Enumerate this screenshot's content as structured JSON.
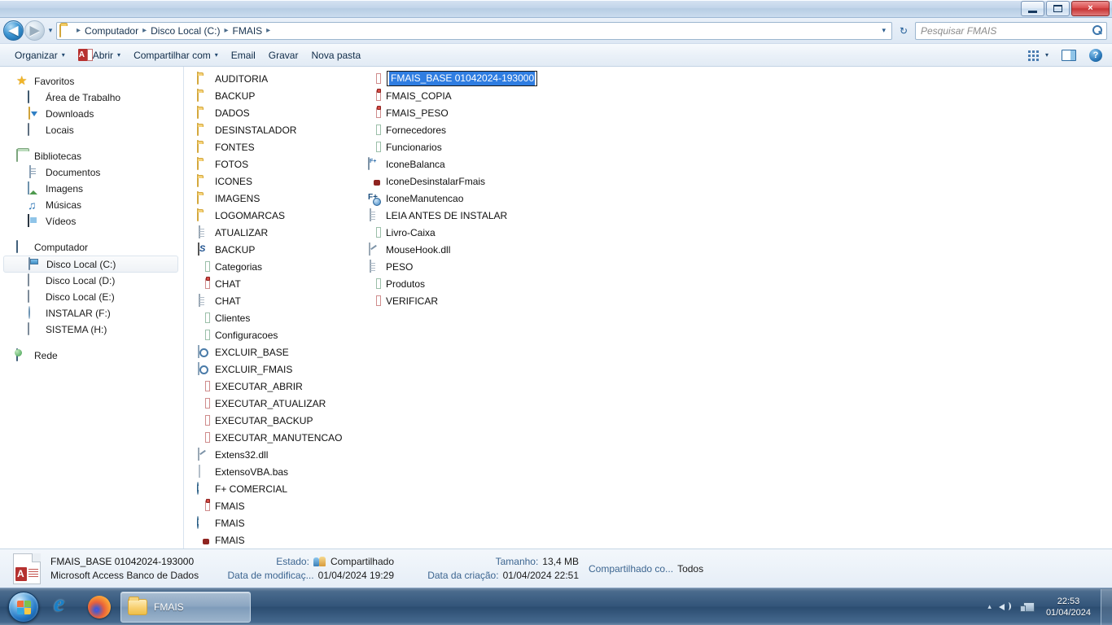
{
  "window": {
    "title": "",
    "controls": {
      "minimize": "minimize-button",
      "maximize": "maximize-button",
      "close": "×"
    }
  },
  "address_bar": {
    "back_label": "◀",
    "forward_label": "▶",
    "history_label": "▾",
    "breadcrumbs": [
      "Computador",
      "Disco Local (C:)",
      "FMAIS"
    ],
    "separator": "▸",
    "dropdown_label": "▾",
    "refresh_label": "↻"
  },
  "search": {
    "placeholder": "Pesquisar FMAIS",
    "value": ""
  },
  "command_bar": {
    "items": [
      {
        "label": "Organizar",
        "has_caret": true,
        "icon": null
      },
      {
        "label": "Abrir",
        "has_caret": true,
        "icon": "access-icon"
      },
      {
        "label": "Compartilhar com",
        "has_caret": true,
        "icon": null
      },
      {
        "label": "Email",
        "has_caret": false,
        "icon": null
      },
      {
        "label": "Gravar",
        "has_caret": false,
        "icon": null
      },
      {
        "label": "Nova pasta",
        "has_caret": false,
        "icon": null
      }
    ],
    "view_caret": "▾",
    "help_label": "?"
  },
  "sidebar": {
    "groups": [
      {
        "header": {
          "label": "Favoritos",
          "icon": "star-icon"
        },
        "items": [
          {
            "label": "Área de Trabalho",
            "icon": "desktop-icon"
          },
          {
            "label": "Downloads",
            "icon": "downloads-icon"
          },
          {
            "label": "Locais",
            "icon": "recent-places-icon"
          }
        ]
      },
      {
        "header": {
          "label": "Bibliotecas",
          "icon": "libraries-icon"
        },
        "items": [
          {
            "label": "Documentos",
            "icon": "documents-icon"
          },
          {
            "label": "Imagens",
            "icon": "pictures-icon"
          },
          {
            "label": "Músicas",
            "icon": "music-icon"
          },
          {
            "label": "Vídeos",
            "icon": "videos-icon"
          }
        ]
      },
      {
        "header": {
          "label": "Computador",
          "icon": "computer-icon"
        },
        "items": [
          {
            "label": "Disco Local (C:)",
            "icon": "hard-drive-system-icon",
            "selected": true
          },
          {
            "label": "Disco Local (D:)",
            "icon": "hard-drive-icon"
          },
          {
            "label": "Disco Local (E:)",
            "icon": "hard-drive-icon"
          },
          {
            "label": "INSTALAR (F:)",
            "icon": "optical-drive-icon"
          },
          {
            "label": "SISTEMA (H:)",
            "icon": "hard-drive-icon"
          }
        ]
      },
      {
        "header": {
          "label": "Rede",
          "icon": "network-icon"
        },
        "items": []
      }
    ]
  },
  "files": {
    "column1": [
      {
        "name": "AUDITORIA",
        "icon": "folder-icon",
        "type": "folder"
      },
      {
        "name": "BACKUP",
        "icon": "folder-icon",
        "type": "folder"
      },
      {
        "name": "DADOS",
        "icon": "folder-icon",
        "type": "folder"
      },
      {
        "name": "DESINSTALADOR",
        "icon": "folder-icon",
        "type": "folder"
      },
      {
        "name": "FONTES",
        "icon": "folder-icon",
        "type": "folder"
      },
      {
        "name": "FOTOS",
        "icon": "folder-icon",
        "type": "folder"
      },
      {
        "name": "ICONES",
        "icon": "folder-icon",
        "type": "folder"
      },
      {
        "name": "IMAGENS",
        "icon": "folder-icon",
        "type": "folder"
      },
      {
        "name": "LOGOMARCAS",
        "icon": "folder-icon",
        "type": "folder"
      },
      {
        "name": "ATUALIZAR",
        "icon": "text-file-icon",
        "type": "txt"
      },
      {
        "name": "BACKUP",
        "icon": "vbscript-icon",
        "type": "vbs"
      },
      {
        "name": "Categorias",
        "icon": "excel-icon",
        "type": "excel"
      },
      {
        "name": "CHAT",
        "icon": "access-locked-icon",
        "type": "access-locked"
      },
      {
        "name": "CHAT",
        "icon": "text-file-icon",
        "type": "txt"
      },
      {
        "name": "Clientes",
        "icon": "excel-icon",
        "type": "excel"
      },
      {
        "name": "Configuracoes",
        "icon": "excel-icon",
        "type": "excel"
      },
      {
        "name": "EXCLUIR_BASE",
        "icon": "vbe-script-icon",
        "type": "vbe"
      },
      {
        "name": "EXCLUIR_FMAIS",
        "icon": "vbe-script-icon",
        "type": "vbe"
      },
      {
        "name": "EXECUTAR_ABRIR",
        "icon": "access-icon",
        "type": "access"
      },
      {
        "name": "EXECUTAR_ATUALIZAR",
        "icon": "access-icon",
        "type": "access"
      },
      {
        "name": "EXECUTAR_BACKUP",
        "icon": "access-icon",
        "type": "access"
      },
      {
        "name": "EXECUTAR_MANUTENCAO",
        "icon": "access-icon",
        "type": "access"
      },
      {
        "name": "Extens32.dll",
        "icon": "dll-icon",
        "type": "dll"
      },
      {
        "name": "ExtensoVBA.bas",
        "icon": "blank-file-icon",
        "type": "bas"
      },
      {
        "name": "F+ COMERCIAL",
        "icon": "fplus-app-icon",
        "type": "app"
      },
      {
        "name": "FMAIS",
        "icon": "access-locked-icon",
        "type": "access-locked"
      },
      {
        "name": "FMAIS",
        "icon": "fplus-app-icon",
        "type": "app"
      }
    ],
    "column2": [
      {
        "name": "FMAIS",
        "icon": "executable-icon",
        "type": "exe"
      },
      {
        "name": "FMAIS_BASE 01042024-193000",
        "icon": "access-icon",
        "type": "access",
        "renaming": true
      },
      {
        "name": "FMAIS_COPIA",
        "icon": "access-locked-icon",
        "type": "access-locked"
      },
      {
        "name": "FMAIS_PESO",
        "icon": "access-locked-icon",
        "type": "access-locked"
      },
      {
        "name": "Fornecedores",
        "icon": "excel-icon",
        "type": "excel"
      },
      {
        "name": "Funcionarios",
        "icon": "excel-icon",
        "type": "excel"
      },
      {
        "name": "IconeBalanca",
        "icon": "balance-app-icon",
        "type": "app"
      },
      {
        "name": "IconeDesinstalarFmais",
        "icon": "executable-icon",
        "type": "exe"
      },
      {
        "name": "IconeManutencao",
        "icon": "maintenance-app-icon",
        "type": "app"
      },
      {
        "name": "LEIA ANTES DE INSTALAR",
        "icon": "text-file-icon",
        "type": "txt"
      },
      {
        "name": "Livro-Caixa",
        "icon": "excel-icon",
        "type": "excel"
      },
      {
        "name": "MouseHook.dll",
        "icon": "dll-icon",
        "type": "dll"
      },
      {
        "name": "PESO",
        "icon": "text-file-icon",
        "type": "txt"
      },
      {
        "name": "Produtos",
        "icon": "excel-icon",
        "type": "excel"
      },
      {
        "name": "VERIFICAR",
        "icon": "access-icon",
        "type": "access"
      }
    ]
  },
  "rename_field": {
    "value": "FMAIS_BASE 01042024-193000",
    "selected": true
  },
  "details_pane": {
    "file_name": "FMAIS_BASE 01042024-193000",
    "file_type": "Microsoft Access Banco de Dados",
    "status_key": "Estado:",
    "status_value": "Compartilhado",
    "modified_key": "Data de modificaç...",
    "modified_value": "01/04/2024 19:29",
    "size_key": "Tamanho:",
    "size_value": "13,4 MB",
    "created_key": "Data da criação:",
    "created_value": "01/04/2024 22:51",
    "shared_with_key": "Compartilhado co...",
    "shared_with_value": "Todos"
  },
  "taskbar": {
    "start_label": "start-orb",
    "quick_launch": [
      {
        "label": "Internet Explorer",
        "icon": "internet-explorer-icon"
      },
      {
        "label": "Mozilla Firefox",
        "icon": "firefox-icon"
      }
    ],
    "windows": [
      {
        "label": "FMAIS",
        "icon": "folder-icon",
        "active": true
      }
    ],
    "tray": {
      "show_hidden": "▴",
      "volume": "volume-icon",
      "network": "network-icon"
    },
    "clock_time": "22:53",
    "clock_date": "01/04/2024"
  },
  "colors": {
    "accent_blue": "#2f7de1",
    "access_red": "#b5312f",
    "excel_green": "#1d7044",
    "folder_yellow": "#f8d070",
    "taskbar": "#33557a"
  }
}
